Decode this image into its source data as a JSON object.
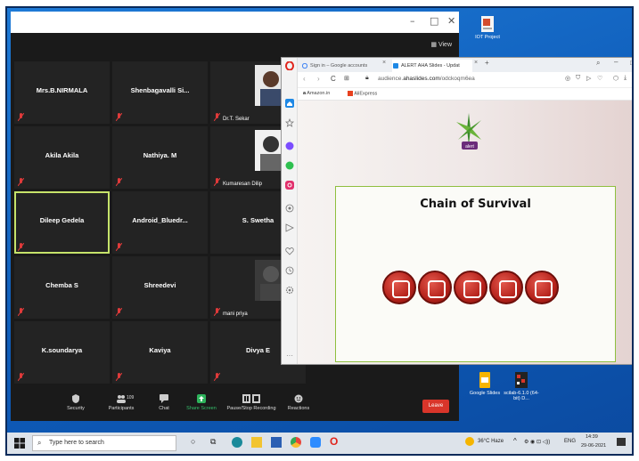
{
  "zoom": {
    "view_label": "View",
    "participants": [
      {
        "name": "Mrs.B.NIRMALA"
      },
      {
        "name": "Shenbagavalli Si..."
      },
      {
        "name": "Dr.T. Sekar",
        "photo": true
      },
      {
        "name": "Akila Akila"
      },
      {
        "name": "Nathiya. M"
      },
      {
        "name": "Kumaresan Dilip",
        "photo": true
      },
      {
        "name": "Dileep Gedela",
        "active": true
      },
      {
        "name": "Android_Bluedr..."
      },
      {
        "name": "S. Swetha"
      },
      {
        "name": "Chemba S"
      },
      {
        "name": "Shreedevi"
      },
      {
        "name": "mani priya",
        "photo": true
      },
      {
        "name": "K.soundarya"
      },
      {
        "name": "Kaviya"
      },
      {
        "name": "Divya E"
      }
    ],
    "toolbar": {
      "security": "Security",
      "participants": "Participants",
      "participants_count": "109",
      "chat": "Chat",
      "share_screen": "Share Screen",
      "record": "Pause/Stop Recording",
      "reactions": "Reactions",
      "leave": "Leave"
    }
  },
  "browser": {
    "tab1": "Sign in – Google accounts",
    "tab2": "ALERT AHA Slides - Updat",
    "url_prefix": "audience.",
    "url_domain": "ahaslides.com",
    "url_path": "/odckoqm6ea",
    "bookmark1": "Amazon.in",
    "bookmark2": "AliExpress",
    "slide_title": "Chain of Survival",
    "logo_text": "alert"
  },
  "desktop": {
    "icons": [
      {
        "label": "IOT Project"
      },
      {
        "label": "Google Slides"
      },
      {
        "label": "scilab-6.1.0 (64-bit) D..."
      }
    ]
  },
  "taskbar": {
    "search_placeholder": "Type here to search",
    "weather": "36°C Haze",
    "lang": "ENG",
    "time": "14:39",
    "date": "29-06-2021"
  },
  "colors": {
    "accent_green": "#c6e36a",
    "leave_red": "#d9352a",
    "chain_red": "#b5221b"
  }
}
